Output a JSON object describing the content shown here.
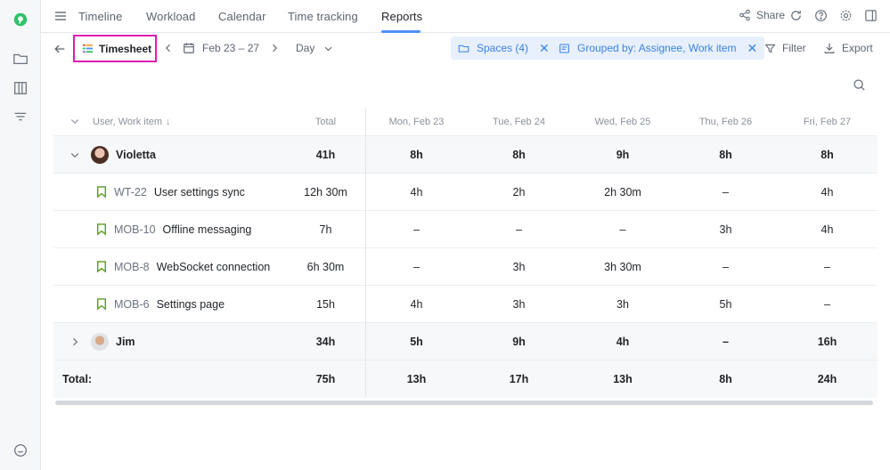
{
  "nav": {
    "tabs": [
      {
        "label": "Timeline"
      },
      {
        "label": "Workload"
      },
      {
        "label": "Calendar"
      },
      {
        "label": "Time tracking"
      },
      {
        "label": "Reports"
      }
    ],
    "active_tab": "Reports",
    "share_label": "Share",
    "accent_color": "#4f8ef7"
  },
  "toolbar": {
    "report_label": "Timesheet",
    "date_range": "Feb 23 – 27",
    "granularity": "Day",
    "spaces_chip": "Spaces (4)",
    "grouped_chip": "Grouped by: Assignee, Work item",
    "filter_label": "Filter",
    "export_label": "Export",
    "highlight_color": "#e01bb4"
  },
  "table": {
    "header": {
      "name": "User, Work item",
      "total": "Total",
      "days": [
        "Mon, Feb 23",
        "Tue, Feb 24",
        "Wed, Feb 25",
        "Thu, Feb 26",
        "Fri, Feb 27"
      ]
    },
    "groups": [
      {
        "user": "Violetta",
        "total": "41h",
        "days": [
          "8h",
          "8h",
          "9h",
          "8h",
          "8h"
        ],
        "items": [
          {
            "key": "WT-22",
            "title": "User settings sync",
            "total": "12h 30m",
            "days": [
              "4h",
              "2h",
              "2h 30m",
              "–",
              "4h"
            ]
          },
          {
            "key": "MOB-10",
            "title": "Offline messaging",
            "total": "7h",
            "days": [
              "–",
              "–",
              "–",
              "3h",
              "4h"
            ]
          },
          {
            "key": "MOB-8",
            "title": "WebSocket connection",
            "total": "6h 30m",
            "days": [
              "–",
              "3h",
              "3h 30m",
              "–",
              "–"
            ]
          },
          {
            "key": "MOB-6",
            "title": "Settings page",
            "total": "15h",
            "days": [
              "4h",
              "3h",
              "3h",
              "5h",
              "–"
            ]
          }
        ]
      },
      {
        "user": "Jim",
        "total": "34h",
        "days": [
          "5h",
          "9h",
          "4h",
          "–",
          "16h"
        ],
        "items": []
      }
    ],
    "totals": {
      "label": "Total:",
      "total": "75h",
      "days": [
        "13h",
        "17h",
        "13h",
        "8h",
        "24h"
      ]
    }
  }
}
